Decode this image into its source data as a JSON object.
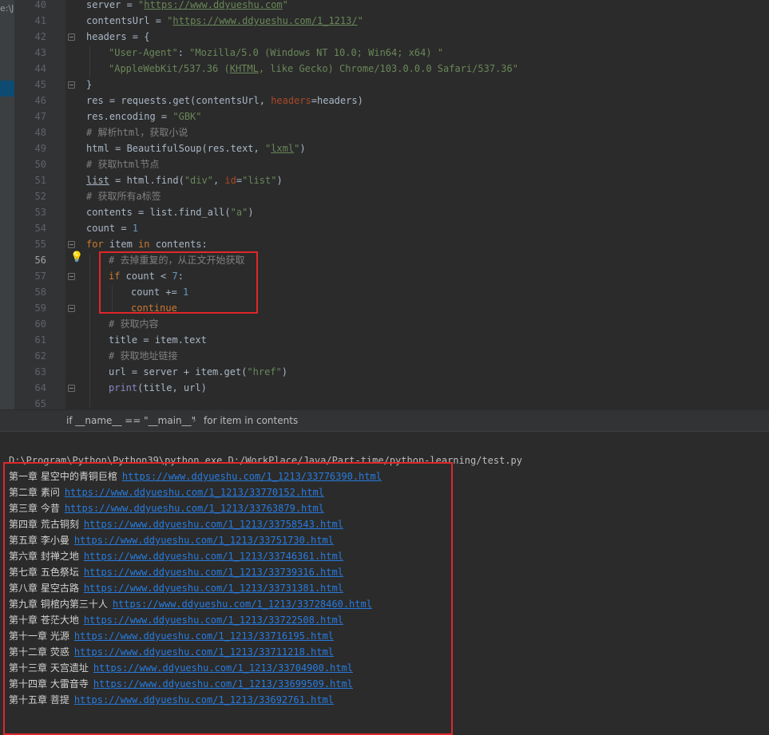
{
  "project_crumb": "e:\\Ja",
  "editor": {
    "line_numbers": [
      "40",
      "41",
      "42",
      "43",
      "44",
      "45",
      "46",
      "47",
      "48",
      "49",
      "50",
      "51",
      "52",
      "53",
      "54",
      "55",
      "56",
      "57",
      "58",
      "59",
      "60",
      "61",
      "62",
      "63",
      "64",
      "65"
    ],
    "current_line": "56",
    "code": {
      "l40": {
        "a": "server = ",
        "b": "\"",
        "c": "https://www.ddyueshu.com",
        "d": "\""
      },
      "l41": {
        "a": "contentsUrl = ",
        "b": "\"",
        "c": "https://www.ddyueshu.com/1_1213/",
        "d": "\""
      },
      "l42": {
        "a": "headers = {"
      },
      "l43": {
        "a": "\"User-Agent\"",
        "b": ": ",
        "c": "\"Mozilla/5.0 (Windows NT 10.0; Win64; x64) \""
      },
      "l44": {
        "a": "\"AppleWebKit/537.36 (",
        "b": "KHTML",
        "c": ", like Gecko) Chrome/103.0.0.0 Safari/537.36\""
      },
      "l45": {
        "a": "}"
      },
      "l46": {
        "a": "res = requests.get(contentsUrl, ",
        "b": "headers",
        "c": "=headers)"
      },
      "l47": {
        "a": "res.encoding = ",
        "b": "\"GBK\""
      },
      "l48": {
        "a": "# 解析html，获取小说"
      },
      "l49": {
        "a": "html = BeautifulSoup(res.text, ",
        "b": "\"",
        "c": "lxml",
        "d": "\"",
        "e": ")"
      },
      "l50": {
        "a": "# 获取html节点"
      },
      "l51": {
        "a": "list",
        "b": " = html.find(",
        "c": "\"div\"",
        "d": ", ",
        "e": "id",
        "f": "=",
        "g": "\"list\"",
        "h": ")"
      },
      "l52": {
        "a": "# 获取所有a标签"
      },
      "l53": {
        "a": "contents = list.find_all(",
        "b": "\"a\"",
        "c": ")"
      },
      "l54": {
        "a": "count = ",
        "b": "1"
      },
      "l55": {
        "a": "for",
        "b": " item ",
        "c": "in",
        "d": " contents:"
      },
      "l56": {
        "a": "# 去掉重复的，从正文开始获取"
      },
      "l57": {
        "a": "if",
        "b": " count < ",
        "c": "7",
        "d": ":"
      },
      "l58": {
        "a": "count += ",
        "b": "1"
      },
      "l59": {
        "a": "continue"
      },
      "l60": {
        "a": "# 获取内容"
      },
      "l61": {
        "a": "title = item.text"
      },
      "l62": {
        "a": "# 获取地址链接"
      },
      "l63": {
        "a": "url = server + item.get(",
        "b": "\"href\"",
        "c": ")"
      },
      "l64": {
        "a": "print",
        "b": "(title, url)"
      }
    }
  },
  "breadcrumb": {
    "item1": "if __name__ == \"__main__\"",
    "separator": "›",
    "item2": "for item in contents"
  },
  "console": {
    "command": "D:\\Program\\Python\\Python39\\python.exe D:/WorkPlace/Java/Part-time/python-learning/test.py",
    "rows": [
      {
        "title": "第一章 星空中的青铜巨棺",
        "url": "https://www.ddyueshu.com/1_1213/33776390.html"
      },
      {
        "title": "第二章 素问",
        "url": "https://www.ddyueshu.com/1_1213/33770152.html"
      },
      {
        "title": "第三章 今昔",
        "url": "https://www.ddyueshu.com/1_1213/33763879.html"
      },
      {
        "title": "第四章 荒古铜刻",
        "url": "https://www.ddyueshu.com/1_1213/33758543.html"
      },
      {
        "title": "第五章 李小曼",
        "url": "https://www.ddyueshu.com/1_1213/33751730.html"
      },
      {
        "title": "第六章 封禅之地",
        "url": "https://www.ddyueshu.com/1_1213/33746361.html"
      },
      {
        "title": "第七章 五色祭坛",
        "url": "https://www.ddyueshu.com/1_1213/33739316.html"
      },
      {
        "title": "第八章 星空古路",
        "url": "https://www.ddyueshu.com/1_1213/33731381.html"
      },
      {
        "title": "第九章 铜棺内第三十人",
        "url": "https://www.ddyueshu.com/1_1213/33728460.html"
      },
      {
        "title": "第十章 苍茫大地",
        "url": "https://www.ddyueshu.com/1_1213/33722508.html"
      },
      {
        "title": "第十一章 光源",
        "url": "https://www.ddyueshu.com/1_1213/33716195.html"
      },
      {
        "title": "第十二章 荧惑",
        "url": "https://www.ddyueshu.com/1_1213/33711218.html"
      },
      {
        "title": "第十三章 天宫遗址",
        "url": "https://www.ddyueshu.com/1_1213/33704900.html"
      },
      {
        "title": "第十四章 大雷音寺",
        "url": "https://www.ddyueshu.com/1_1213/33699509.html"
      },
      {
        "title": "第十五章 菩提",
        "url": "https://www.ddyueshu.com/1_1213/33692761.html"
      }
    ]
  },
  "colors": {
    "background": "#2b2b2b",
    "keyword": "#cc7832",
    "string": "#6a8759",
    "number": "#6897bb",
    "comment": "#808080",
    "link": "#287bde",
    "highlight_border": "#e0272a"
  }
}
